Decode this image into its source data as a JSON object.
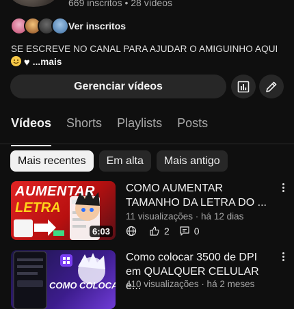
{
  "channel": {
    "stats": "669 inscritos • 28 vídeos",
    "subscribers_link": "Ver inscritos",
    "description": "SE ESCREVE NO CANAL PARA AJUDAR O AMIGUINHO AQUI",
    "more_label": "...mais"
  },
  "actions": {
    "manage_label": "Gerenciar vídeos",
    "analytics_icon": "bar-chart-icon",
    "edit_icon": "pencil-icon"
  },
  "tabs": [
    {
      "label": "Vídeos",
      "active": true
    },
    {
      "label": "Shorts",
      "active": false
    },
    {
      "label": "Playlists",
      "active": false
    },
    {
      "label": "Posts",
      "active": false
    }
  ],
  "filters": [
    {
      "label": "Mais recentes",
      "active": true
    },
    {
      "label": "Em alta",
      "active": false
    },
    {
      "label": "Mais antigo",
      "active": false
    }
  ],
  "videos": [
    {
      "title": "COMO AUMENTAR TAMANHO DA LETRA DO ...",
      "meta": "11 visualizações · há 12 dias",
      "duration": "6:03",
      "likes": "2",
      "comments": "0",
      "thumb_text_1": "AUMENTAR",
      "thumb_text_2": "LETRA"
    },
    {
      "title": "Como colocar 3500 de DPI em QUALQUER CELULAR e...",
      "meta": "410 visualizações · há 2 meses",
      "thumb_text_1": "COMO COLOCAR"
    }
  ],
  "colors": {
    "background": "#0f0f0f",
    "surface": "#272727",
    "text": "#f1f1f1",
    "secondary_text": "#aaaaaa"
  }
}
